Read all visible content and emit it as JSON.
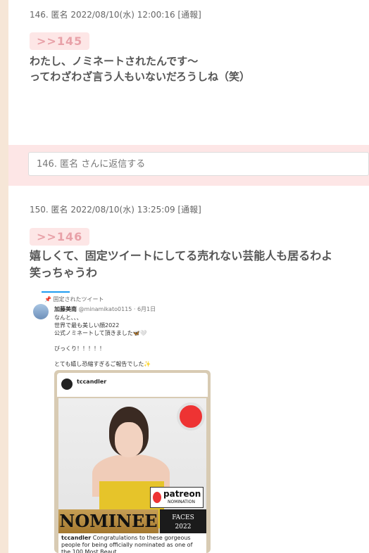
{
  "posts": [
    {
      "meta": "146. 匿名 2022/08/10(水) 12:00:16 [通報]",
      "anchor": ">>145",
      "lines": [
        "わたし、ノミネートされたんです～",
        "ってわざわざ言う人もいないだろうしね（笑）"
      ]
    },
    {
      "meta": "150. 匿名 2022/08/10(水) 13:25:09 [通報]",
      "anchor": ">>146",
      "lines": [
        "嬉しくて、固定ツイートにしてる売れない芸能人も居るわよ",
        "笑っちゃうわ"
      ]
    }
  ],
  "reply": {
    "placeholder": "146. 匿名 さんに返信する"
  },
  "tweet": {
    "pinned_label": "固定されたツイート",
    "author": "加藤美南",
    "handle_date": "@minamikato0115 · 6月1日",
    "text_lines": [
      "なんと、、、",
      "世界で最も美しい顔2022",
      "公式ノミネートして頂きました🦋🤍",
      "",
      "びっくり！！！！！",
      "",
      "とても嬉し恐縮すぎるご報告でした✨"
    ],
    "card_handle": "tccandler",
    "badge_main": "patreon",
    "badge_sub": "NOMINATION",
    "nominee": "NOMINEE",
    "faces": "FACES",
    "year": "2022",
    "caption_user": "tccandler",
    "caption_text": "Congratulations to these gorgeous people for being officially nominated as one of the 100 Most Beaut"
  }
}
